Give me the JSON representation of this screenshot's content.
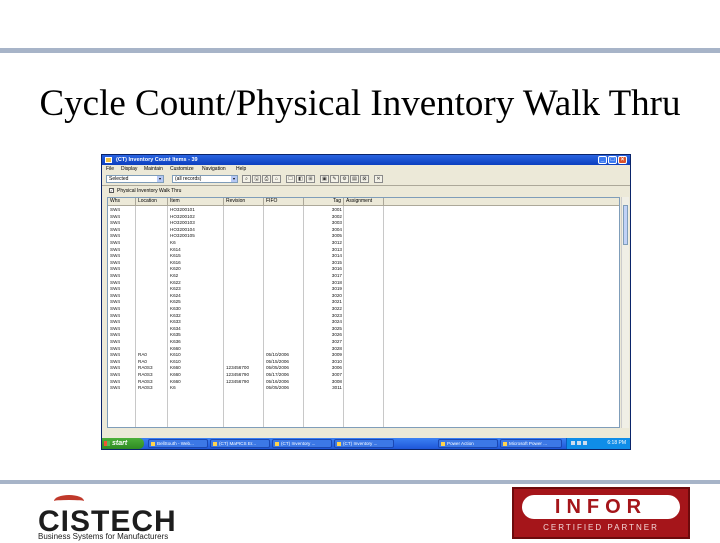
{
  "slide": {
    "title": "Cycle Count/Physical Inventory Walk Thru"
  },
  "window": {
    "title": "(CT) Inventory Count Items - 39",
    "controls": [
      "_",
      "□",
      "×"
    ]
  },
  "menu": [
    "File",
    "Display",
    "Maintain",
    "Customize",
    "Navigation",
    "Help"
  ],
  "toolbar": {
    "view_combo": "Selected",
    "filter_combo": "(all records)",
    "buttons": [
      "⌕",
      "🖫",
      "⎙",
      "⌂",
      "☐",
      "◧",
      "⊞",
      "▣",
      "✎",
      "⚙",
      "▤",
      "⊠",
      "✕"
    ]
  },
  "filter": {
    "checkbox_label": "Physical Inventory Walk Thru"
  },
  "grid": {
    "columns": [
      "Whs",
      "Location",
      "Item",
      "Revision",
      "FIFO",
      "Tag",
      "Assignment"
    ],
    "rows": [
      [
        "SW4",
        "",
        "HO3200101",
        "",
        "",
        "3001",
        ""
      ],
      [
        "SW4",
        "",
        "HO3200102",
        "",
        "",
        "3002",
        ""
      ],
      [
        "SW4",
        "",
        "HO3200103",
        "",
        "",
        "3003",
        ""
      ],
      [
        "SW4",
        "",
        "HO3200104",
        "",
        "",
        "3004",
        ""
      ],
      [
        "SW4",
        "",
        "HO3200105",
        "",
        "",
        "3005",
        ""
      ],
      [
        "SW4",
        "",
        "K6",
        "",
        "",
        "3012",
        ""
      ],
      [
        "SW4",
        "",
        "K614",
        "",
        "",
        "3013",
        ""
      ],
      [
        "SW4",
        "",
        "K615",
        "",
        "",
        "3014",
        ""
      ],
      [
        "SW4",
        "",
        "K616",
        "",
        "",
        "3015",
        ""
      ],
      [
        "SW4",
        "",
        "K620",
        "",
        "",
        "3016",
        ""
      ],
      [
        "SW4",
        "",
        "K62",
        "",
        "",
        "3017",
        ""
      ],
      [
        "SW4",
        "",
        "K622",
        "",
        "",
        "3018",
        ""
      ],
      [
        "SW4",
        "",
        "K623",
        "",
        "",
        "3019",
        ""
      ],
      [
        "SW4",
        "",
        "K624",
        "",
        "",
        "3020",
        ""
      ],
      [
        "SW4",
        "",
        "K625",
        "",
        "",
        "3021",
        ""
      ],
      [
        "SW4",
        "",
        "K630",
        "",
        "",
        "3022",
        ""
      ],
      [
        "SW4",
        "",
        "K632",
        "",
        "",
        "3023",
        ""
      ],
      [
        "SW4",
        "",
        "K633",
        "",
        "",
        "3024",
        ""
      ],
      [
        "SW4",
        "",
        "K634",
        "",
        "",
        "3025",
        ""
      ],
      [
        "SW4",
        "",
        "K635",
        "",
        "",
        "3026",
        ""
      ],
      [
        "SW4",
        "",
        "K636",
        "",
        "",
        "3027",
        ""
      ],
      [
        "SW4",
        "",
        "K660",
        "",
        "",
        "3028",
        ""
      ],
      [
        "SW4",
        "RA0",
        "K610",
        "",
        "05/10/2006",
        "3009",
        ""
      ],
      [
        "SW4",
        "RA0",
        "K610",
        "",
        "05/15/2006",
        "3010",
        ""
      ],
      [
        "SW4",
        "RA0S3",
        "K660",
        "123456700",
        "05/05/2006",
        "3006",
        ""
      ],
      [
        "SW4",
        "RA0S3",
        "K660",
        "123456790",
        "05/17/2006",
        "3007",
        ""
      ],
      [
        "SW4",
        "RA0S3",
        "K660",
        "123456790",
        "05/16/2006",
        "3008",
        ""
      ],
      [
        "SW4",
        "RA0S3",
        "K6",
        "",
        "05/05/2006",
        "3011",
        ""
      ]
    ]
  },
  "taskbar": {
    "start_label": "start",
    "items": [
      "BellSouth - Web...",
      "(CT) MaPICS Er...",
      "(CT) Inventory ...",
      "(CT) Inventory ...",
      "Power Action",
      "Microsoft Power ..."
    ],
    "clock": "6:18 PM"
  },
  "logos": {
    "cistech_name": "CISTECH",
    "cistech_tagline": "Business Systems for Manufacturers",
    "infor_name": "INFOR",
    "infor_sub": "CERTIFIED PARTNER"
  },
  "colors": {
    "rule": "#a7b4c8",
    "titlebar": "#0b3fbf",
    "taskbar": "#1e56d8",
    "start": "#2e8b22",
    "infor_red": "#a5151a"
  }
}
